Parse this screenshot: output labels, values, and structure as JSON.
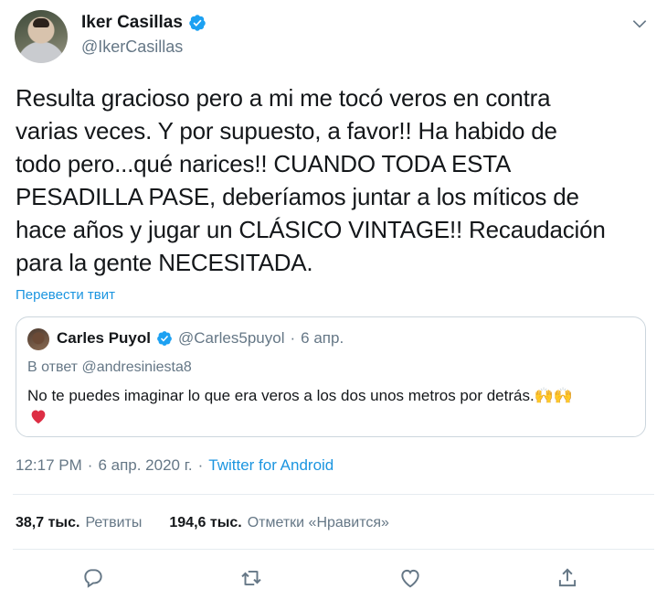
{
  "author": {
    "name": "Iker Casillas",
    "handle": "@IkerCasillas"
  },
  "tweet": {
    "text": "Resulta gracioso pero a mi me tocó veros en contra\nvarias veces. Y por supuesto, a favor!! Ha habido de\ntodo pero...qué narices!! CUANDO TODA ESTA\nPESADILLA PASE, deberíamos juntar a los míticos de\nhace años y jugar un CLÁSICO VINTAGE!! Recaudación\npara la gente NECESITADA.",
    "translate_label": "Перевести твит"
  },
  "quote": {
    "name": "Carles Puyol",
    "handle": "@Carles5puyol",
    "separator": "·",
    "date": "6 апр.",
    "reply_to": "В ответ @andresiniesta8",
    "text": "No te puedes imaginar lo que era veros a los dos unos metros por detrás.🙌🙌"
  },
  "meta": {
    "time": "12:17 PM",
    "separator": "·",
    "date": "6 апр. 2020 г.",
    "separator2": "·",
    "source": "Twitter for Android"
  },
  "stats": {
    "retweets_count": "38,7 тыс.",
    "retweets_label": "Ретвиты",
    "likes_count": "194,6 тыс.",
    "likes_label": "Отметки «Нравится»"
  },
  "icons": {
    "verified": "verified-badge-icon",
    "more": "chevron-down-icon",
    "reply": "reply-icon",
    "retweet": "retweet-icon",
    "like": "heart-icon",
    "share": "share-icon"
  },
  "colors": {
    "accent": "#1b95e0",
    "verified": "#1da1f2",
    "secondary_text": "#657786",
    "heart": "#e0245e"
  }
}
